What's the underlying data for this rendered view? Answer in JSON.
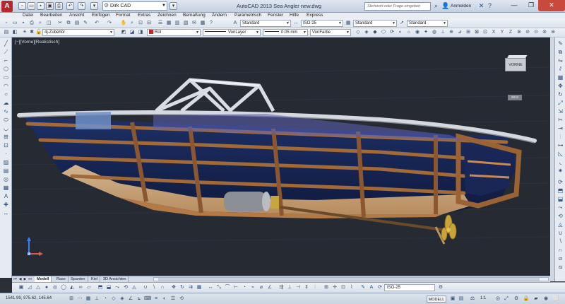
{
  "window": {
    "title": "AutoCAD 2013    Sea Angler new.dwg",
    "app_logo": "A",
    "workspace": "Dirk CAD",
    "search_placeholder": "Stichwort oder Frage eingeben",
    "signin_label": "Anmelden"
  },
  "menu": [
    "Datei",
    "Bearbeiten",
    "Ansicht",
    "Einfügen",
    "Format",
    "Extras",
    "Zeichnen",
    "Bemaßung",
    "Ändern",
    "Parametrisch",
    "Fenster",
    "Hilfe",
    "Express"
  ],
  "styles_toolbar": {
    "text_style": "Standard",
    "dim_style": "ISO-25",
    "table_style": "Standard",
    "multileader_style": "Standard"
  },
  "properties_toolbar": {
    "layer": "4j-Zubehör",
    "color": "Rot",
    "linetype": "VonLayer",
    "lineweight": "0.05 mm",
    "plotstyle": "VonFarbe",
    "color_hex": "#c8232c"
  },
  "viewport": {
    "label": "[−][Vorne][Realistisch]",
    "viewcube_face": "VORNE",
    "wcs_badge": "WKS",
    "background": "#262b33"
  },
  "layout_tabs": [
    "Modell",
    "Rase",
    "Spanten",
    "Kiel",
    "3D Ansichten"
  ],
  "bottom_toolbar": {
    "dim_style": "ISO-25"
  },
  "status": {
    "coordinates": "1541.99, 975.62, 145.64",
    "model_label": "MODELL",
    "scale": "1:1"
  }
}
